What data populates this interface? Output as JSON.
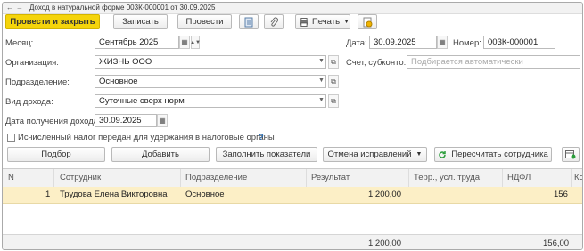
{
  "window": {
    "title": "Доход в натуральной форме 003К-000001 от 30.09.2025",
    "back_icon": "←",
    "forward_icon": "→"
  },
  "toolbar": {
    "post_close": "Провести и закрыть",
    "save": "Записать",
    "post": "Провести",
    "print": "Печать"
  },
  "form": {
    "month_label": "Месяц:",
    "month_value": "Сентябрь 2025",
    "date_label": "Дата:",
    "date_value": "30.09.2025",
    "number_label": "Номер:",
    "number_value": "003К-000001",
    "org_label": "Организация:",
    "org_value": "ЖИЗНЬ ООО",
    "account_label": "Счет, субконто:",
    "account_placeholder": "Подбирается автоматически",
    "dept_label": "Подразделение:",
    "dept_value": "Основное",
    "income_type_label": "Вид дохода:",
    "income_type_value": "Суточные сверх норм",
    "receipt_date_label": "Дата получения дохода:",
    "receipt_date_value": "30.09.2025",
    "tax_checkbox_label": "Исчисленный налог передан для удержания в налоговые органы",
    "help": "?"
  },
  "table_toolbar": {
    "select": "Подбор",
    "add": "Добавить",
    "fill": "Заполнить показатели",
    "cancel_corrections": "Отмена исправлений",
    "recalc": "Пересчитать сотрудника"
  },
  "table": {
    "columns": [
      "N",
      "Сотрудник",
      "Подразделение",
      "Результат",
      "Терр., усл. труда",
      "НДФЛ",
      "Ко"
    ],
    "rows": [
      {
        "n": "1",
        "employee": "Трудова Елена Викторовна",
        "dept": "Основное",
        "result": "1 200,00",
        "terr": "",
        "ndfl": "156"
      }
    ],
    "totals": {
      "result": "1 200,00",
      "ndfl": "156,00"
    }
  },
  "colors": {
    "primary_button": "#f5d40b",
    "selected_row": "#fcefc6",
    "recalc_icon": "#2a9d3a"
  }
}
